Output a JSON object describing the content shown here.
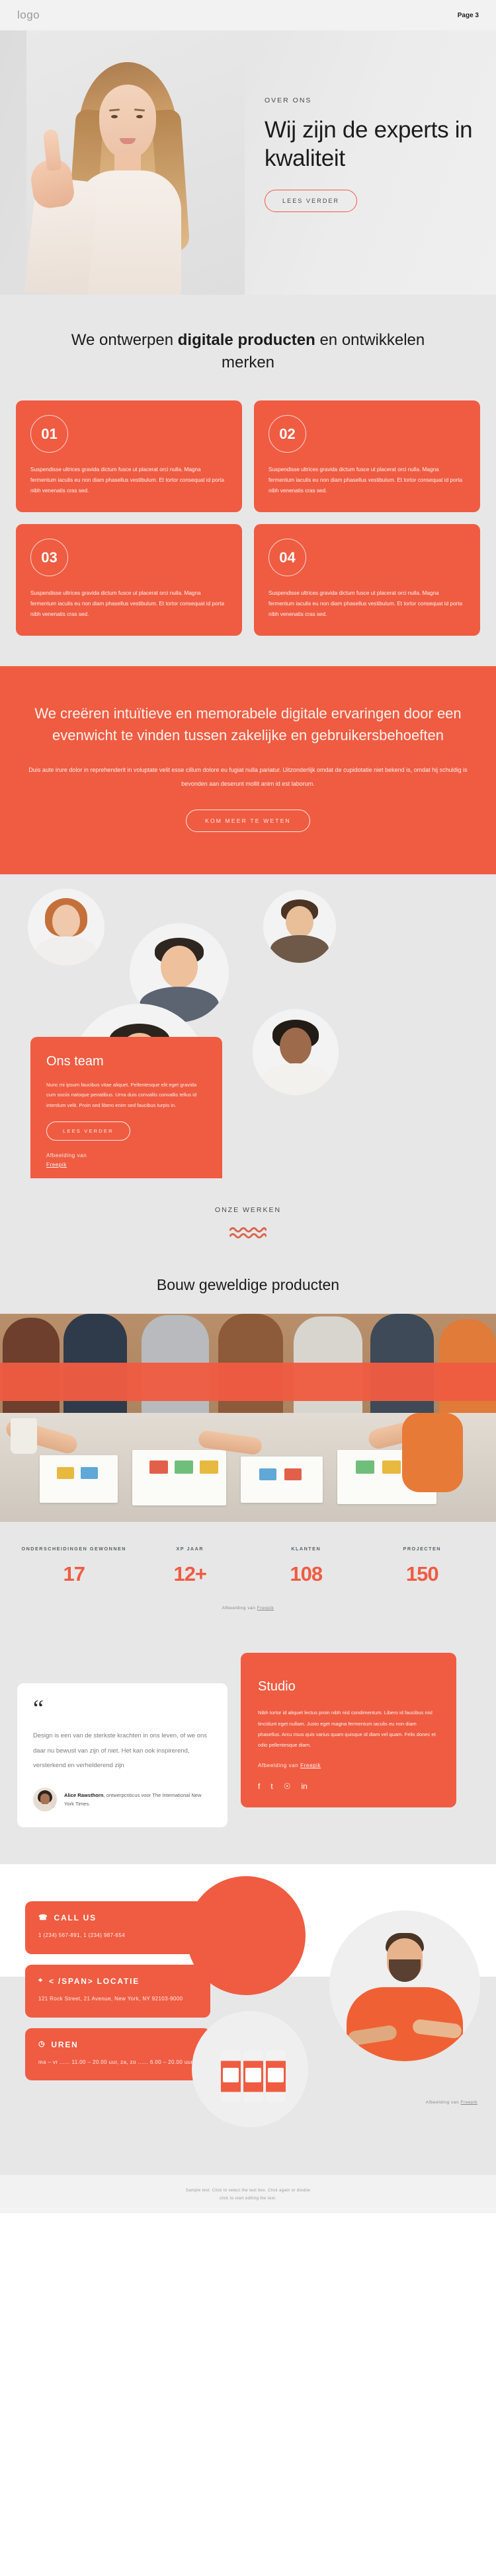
{
  "topbar": {
    "logo": "logo",
    "page_label": "Page 3"
  },
  "hero": {
    "eyebrow": "OVER ONS",
    "title": "Wij zijn de experts in kwaliteit",
    "cta": "LEES VERDER"
  },
  "services": {
    "title_part1": "We ontwerpen ",
    "title_bold1": "digitale producten",
    "title_part2": " en ontwikkelen merken",
    "cards": [
      {
        "number": "01",
        "text": "Suspendisse ultrices gravida dictum fusce ut placerat orci nulla. Magna fermentum iaculis eu non diam phasellus vestibulum. Et tortor consequat id porta nibh venenatis cras sed."
      },
      {
        "number": "02",
        "text": "Suspendisse ultrices gravida dictum fusce ut placerat orci nulla. Magna fermentum iaculis eu non diam phasellus vestibulum. Et tortor consequat id porta nibh venenatis cras sed."
      },
      {
        "number": "03",
        "text": "Suspendisse ultrices gravida dictum fusce ut placerat orci nulla. Magna fermentum iaculis eu non diam phasellus vestibulum. Et tortor consequat id porta nibh venenatis cras sed."
      },
      {
        "number": "04",
        "text": "Suspendisse ultrices gravida dictum fusce ut placerat orci nulla. Magna fermentum iaculis eu non diam phasellus vestibulum. Et tortor consequat id porta nibh venenatis cras sed."
      }
    ]
  },
  "band": {
    "heading": "We creëren intuïtieve en memorabele digitale ervaringen door een evenwicht te vinden tussen zakelijke en gebruikersbehoeften",
    "paragraph": "Duis aute irure dolor in reprehenderit in voluptate velit esse cillum dolore eu fugiat nulla pariatur. Uitzonderlijk omdat de cupidotatie niet bekend is, omdat hij schuldig is bevonden aan deserunt mollit anim id est laborum.",
    "cta": "KOM MEER TE WETEN"
  },
  "team": {
    "title": "Ons team",
    "text": "Nunc mi ipsum faucibus vitae aliquet. Pellentesque elit eget gravida cum sociis natoque penatibus. Urna duis convallis convallis tellus id interdum velit. Proin sed libero enim sed faucibus turpis in.",
    "cta": "LEES VERDER",
    "credit_prefix": "Afbeelding van",
    "credit_link": "Freepik"
  },
  "works": {
    "eyebrow": "ONZE WERKEN",
    "title": "Bouw geweldige producten",
    "credit_prefix": "Afbeelding van",
    "credit_link": "Freepik"
  },
  "stats": [
    {
      "label": "ONDERSCHEIDINGEN GEWONNEN",
      "value": "17"
    },
    {
      "label": "XP JAAR",
      "value": "12+"
    },
    {
      "label": "KLANTEN",
      "value": "108"
    },
    {
      "label": "PROJECTEN",
      "value": "150"
    }
  ],
  "quote": {
    "mark": "“",
    "text": "Design is een van de sterkste krachten in ons leven, of we ons daar nu bewust van zijn of niet. Het kan ook inspirerend, versterkend en verhelderend zijn",
    "author_name": "Alice Rawsthorn",
    "author_role": ", ontwerpcriticus voor The International New York Times."
  },
  "studio": {
    "title": "Studio",
    "text": "Nibh tortor id aliquet lectus proin nibh nisl condimentum. Libero id faucibus nisl tincidunt eget nullam. Justo eget magna fermentum iaculis eu non diam phasellus. Arcu risus quis varius quam quisque id diam vel quam. Felis donec et odio pellentesque diam.",
    "credit_prefix": "Afbeelding van",
    "credit_link": "Freepik",
    "socials": [
      "f",
      "t",
      "☉",
      "in"
    ]
  },
  "contact": {
    "cards": [
      {
        "icon": "☎",
        "icon_name": "phone-icon",
        "title": "CALL US",
        "text": "1 (234) 567-891, 1 (234) 987-654"
      },
      {
        "icon": "⌖",
        "icon_name": "location-pin-icon",
        "title": "< /SPAN> LOCATIE",
        "text": "121 Rock Street, 21 Avenue, New York, NY 92103-9000"
      },
      {
        "icon": "◷",
        "icon_name": "clock-icon",
        "title": "UREN",
        "text": "ma – vr ...... 11.00 – 20.00 uur, za, zo ...... 6.00 – 20.00 uur"
      }
    ],
    "credit_prefix": "Afbeelding van",
    "credit_link": "Freepik"
  },
  "footer": {
    "line1": "Sample text. Click to select the text box. Click again or double",
    "line2": "click to start editing the text."
  },
  "colors": {
    "accent": "#ef5c42",
    "page_bg": "#e7e7e7",
    "bar_bg": "#f2f2f2",
    "text": "#1c1c1c"
  }
}
